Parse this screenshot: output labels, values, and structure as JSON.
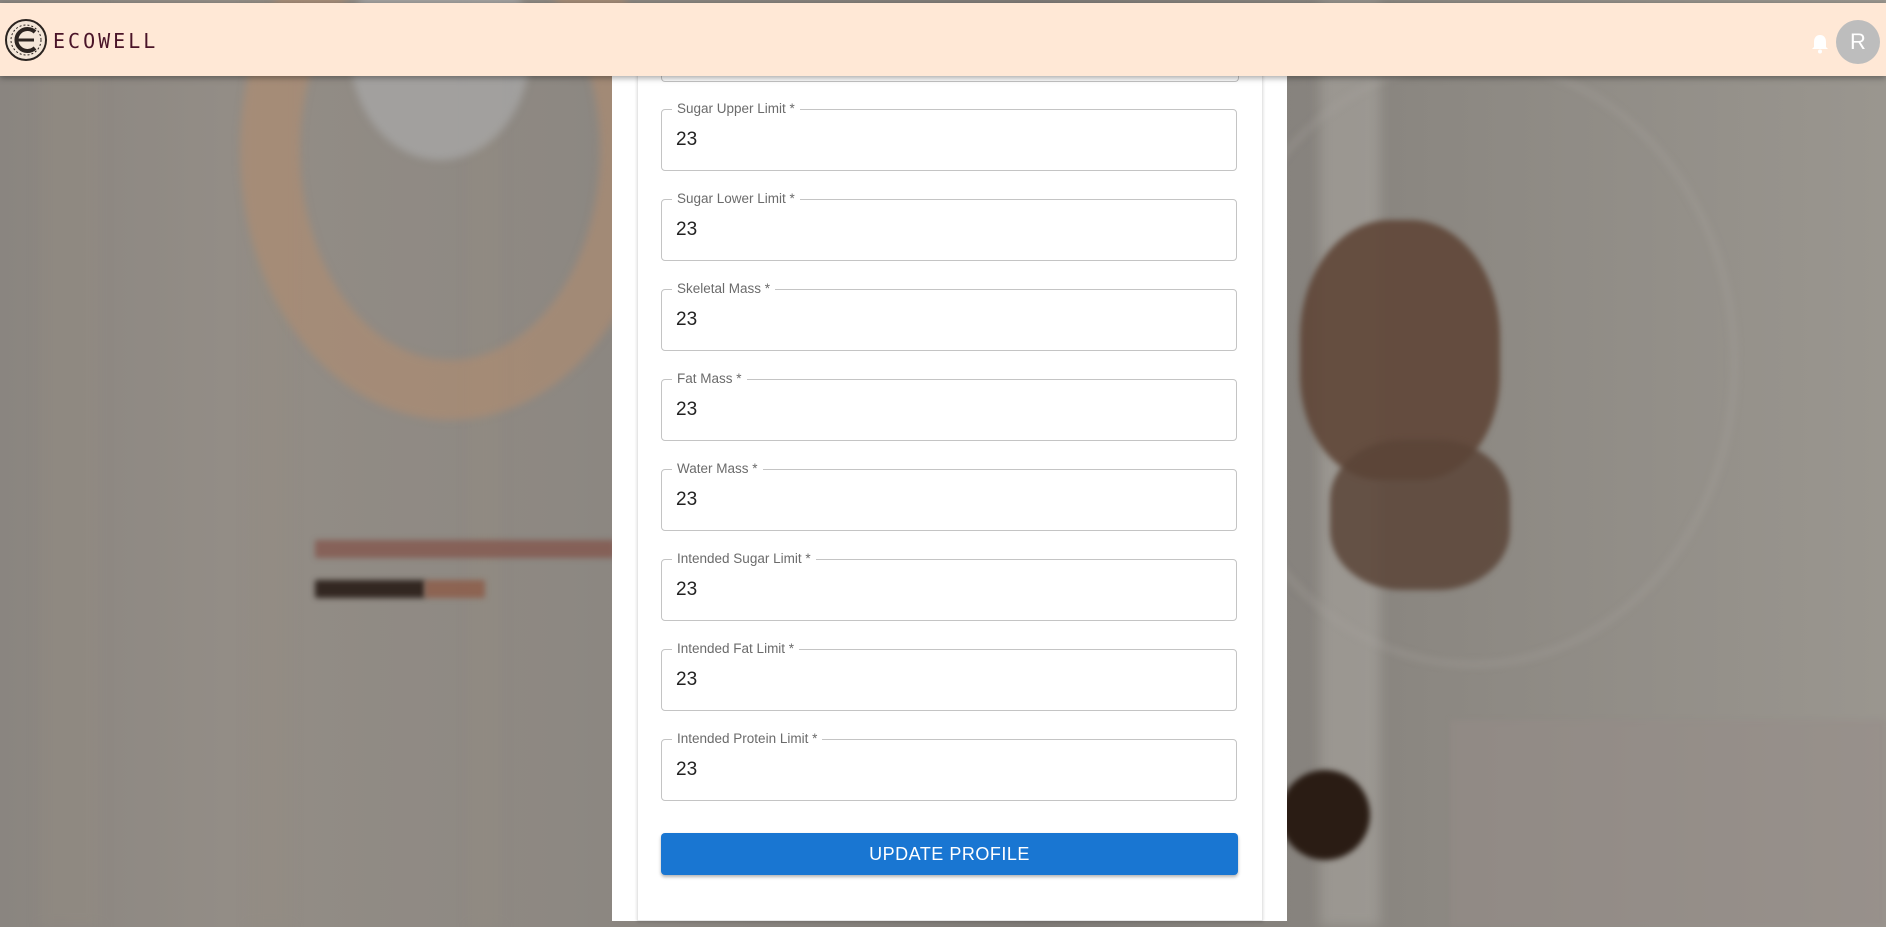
{
  "header": {
    "brand": "ECOWELL",
    "avatar_initial": "R",
    "bg_color": "#ffe8d6"
  },
  "icons": [
    "logo-emblem-icon",
    "bell-icon"
  ],
  "form": {
    "fields": [
      {
        "label": "Sugar Upper Limit *",
        "value": "23"
      },
      {
        "label": "Sugar Lower Limit *",
        "value": "23"
      },
      {
        "label": "Skeletal Mass *",
        "value": "23"
      },
      {
        "label": "Fat Mass *",
        "value": "23"
      },
      {
        "label": "Water Mass *",
        "value": "23"
      },
      {
        "label": "Intended Sugar Limit *",
        "value": "23"
      },
      {
        "label": "Intended Fat Limit *",
        "value": "23"
      },
      {
        "label": "Intended Protein Limit *",
        "value": "23"
      }
    ],
    "submit_label": "UPDATE PROFILE",
    "accent_color": "#1976d2"
  }
}
